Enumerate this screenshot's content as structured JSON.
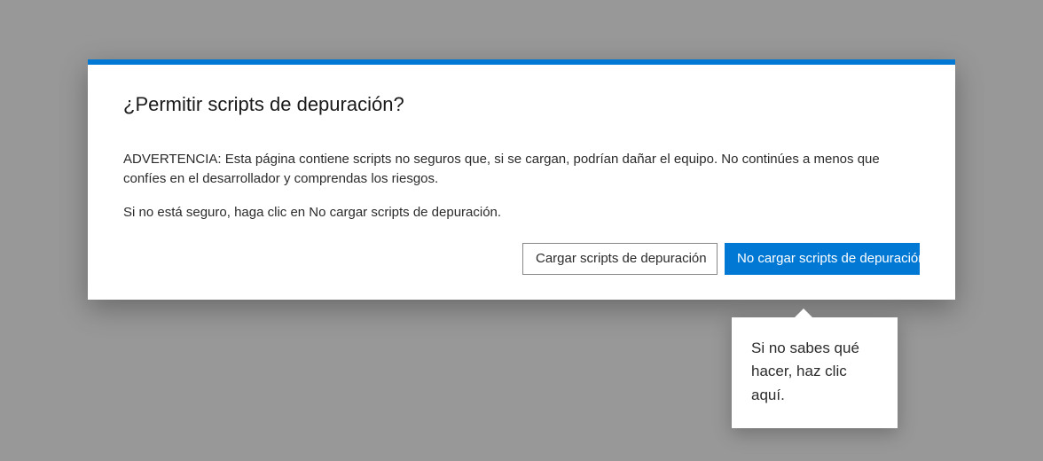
{
  "dialog": {
    "title": "¿Permitir scripts de depuración?",
    "warning": "ADVERTENCIA: Esta página contiene scripts no seguros que, si se cargan, podrían dañar el equipo. No continúes a menos que confíes en el desarrollador y comprendas los riesgos.",
    "hint": "Si no está seguro, haga clic en No cargar scripts de depuración.",
    "secondary_button": "Cargar scripts de depuración",
    "primary_button": "No cargar scripts de depuración"
  },
  "tooltip": {
    "text": "Si no sabes qué hacer, haz clic aquí."
  }
}
